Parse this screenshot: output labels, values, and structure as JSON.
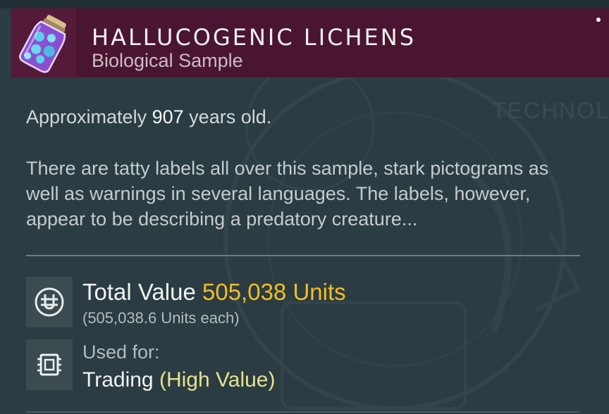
{
  "item": {
    "name": "HALLUCOGENIC LICHENS",
    "category": "Biological Sample",
    "icon": "specimen-jar-icon"
  },
  "description": {
    "age_prefix": "Approximately",
    "age_value": "907",
    "age_suffix": "years old.",
    "text": "There are tatty labels all over this sample, stark pictograms as well as warnings in several languages. The labels, however, appear to be describing a predatory creature..."
  },
  "value": {
    "icon": "units-currency-icon",
    "label": "Total Value",
    "amount": "505,038 Units",
    "each": "(505,038.6 Units each)"
  },
  "usage": {
    "icon": "chip-icon",
    "label": "Used for:",
    "value": "Trading",
    "tag": "(High Value)"
  },
  "background": {
    "watermark_text": "TECHNOL"
  },
  "colors": {
    "header_bg": "#4a1530",
    "panel_bg": "#2b3c42",
    "value_accent": "#f3be27",
    "tag_accent": "#e6e290"
  }
}
